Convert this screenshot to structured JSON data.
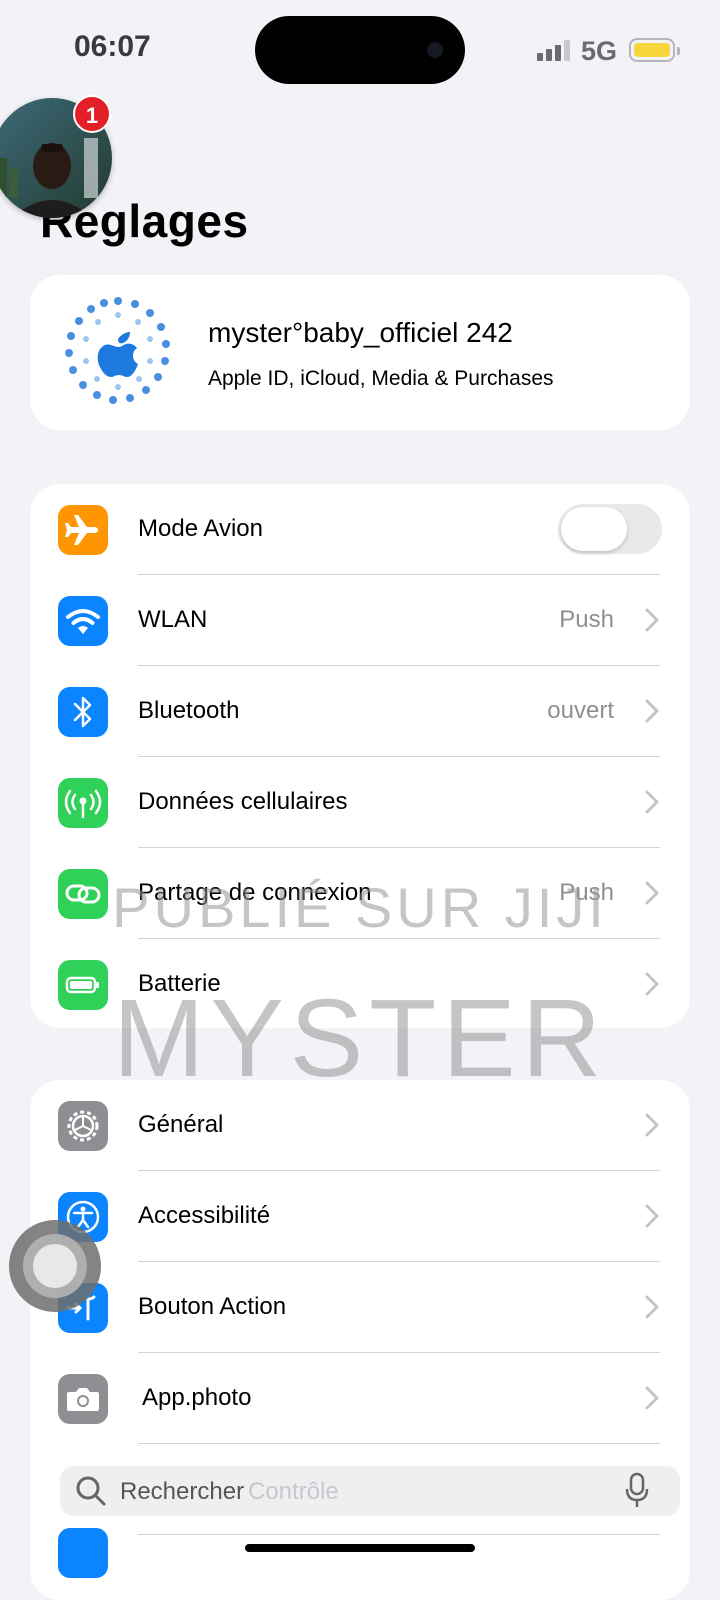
{
  "status_bar": {
    "time": "06:07",
    "network": "5G",
    "signal_icon": "cellular-signal-icon",
    "battery_icon": "battery-icon",
    "battery_color": "#f7d53b"
  },
  "notification": {
    "badge_count": "1"
  },
  "page": {
    "title": "Reglages"
  },
  "profile": {
    "name": "myster°baby_officiel 242",
    "subtitle": "Apple ID, iCloud, Media & Purchases",
    "icon": "apple-logo-icon"
  },
  "connectivity": {
    "rows": [
      {
        "label": "Mode Avion",
        "value": "",
        "icon": "airplane-icon",
        "color": "#ff9500",
        "toggle": false
      },
      {
        "label": "WLAN",
        "value": "Push",
        "icon": "wifi-icon",
        "color": "#0a84ff"
      },
      {
        "label": "Bluetooth",
        "value": "ouvert",
        "icon": "bluetooth-icon",
        "color": "#0a84ff"
      },
      {
        "label": "Données cellulaires",
        "value": "",
        "icon": "antenna-icon",
        "color": "#30d158"
      },
      {
        "label": "Partage de connexion",
        "value": "Push",
        "icon": "link-icon",
        "color": "#30d158"
      },
      {
        "label": "Batterie",
        "value": "",
        "icon": "battery-green-icon",
        "color": "#30d158"
      }
    ]
  },
  "general_group": {
    "rows": [
      {
        "label": "Général",
        "icon": "gear-icon",
        "color": "#8e8e93"
      },
      {
        "label": "Accessibilité",
        "icon": "accessibility-icon",
        "color": "#0a84ff"
      },
      {
        "label": "Bouton Action",
        "icon": "action-button-icon",
        "color": "#0a84ff"
      },
      {
        "label": "App.photo",
        "icon": "camera-icon",
        "color": "#8e8e93"
      }
    ]
  },
  "watermark": {
    "line1": "PUBLIÉ SUR JIJI",
    "line2": "MYSTER"
  },
  "search": {
    "label": "Rechercher",
    "ghost_text": "Contrôle",
    "icon": "search-icon",
    "mic_icon": "microphone-icon"
  }
}
